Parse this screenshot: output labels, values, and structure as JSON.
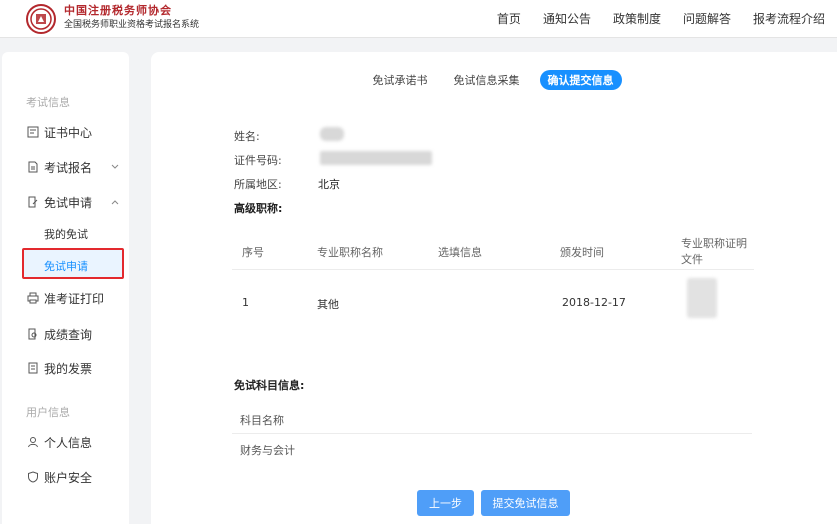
{
  "header": {
    "brand_title": "中国注册税务师协会",
    "brand_subtitle": "全国税务师职业资格考试报名系统",
    "nav": [
      "首页",
      "通知公告",
      "政策制度",
      "问题解答",
      "报考流程介绍"
    ]
  },
  "sidebar": {
    "group_exam": "考试信息",
    "items": [
      {
        "label": "证书中心",
        "icon": "certificate-icon"
      },
      {
        "label": "考试报名",
        "icon": "document-icon"
      },
      {
        "label": "免试申请",
        "icon": "edit-icon"
      }
    ],
    "sub_items": [
      {
        "label": "我的免试"
      },
      {
        "label": "免试申请"
      }
    ],
    "items_more": [
      {
        "label": "准考证打印",
        "icon": "printer-icon"
      },
      {
        "label": "成绩查询",
        "icon": "search-doc-icon"
      },
      {
        "label": "我的发票",
        "icon": "invoice-icon"
      }
    ],
    "group_user": "用户信息",
    "user_items": [
      {
        "label": "个人信息",
        "icon": "person-icon"
      },
      {
        "label": "账户安全",
        "icon": "shield-icon"
      }
    ]
  },
  "steps": [
    "免试承诺书",
    "免试信息采集",
    "确认提交信息"
  ],
  "form": {
    "name_label": "姓名:",
    "id_label": "证件号码:",
    "region_label": "所属地区:",
    "region_value": "北京",
    "title_label": "高级职称:"
  },
  "title_table": {
    "headers": [
      "序号",
      "专业职称名称",
      "选填信息",
      "颁发时间",
      "专业职称证明文件"
    ],
    "rows": [
      {
        "index": "1",
        "name": "其他",
        "extra": "",
        "date": "2018-12-17"
      }
    ]
  },
  "exempt": {
    "section_title": "免试科目信息:",
    "header": "科目名称",
    "rows": [
      "财务与会计"
    ]
  },
  "buttons": {
    "prev": "上一步",
    "submit": "提交免试信息"
  },
  "colors": {
    "accent": "#1890ff",
    "brand": "#b3282d",
    "highlight_border": "#e3292e"
  }
}
